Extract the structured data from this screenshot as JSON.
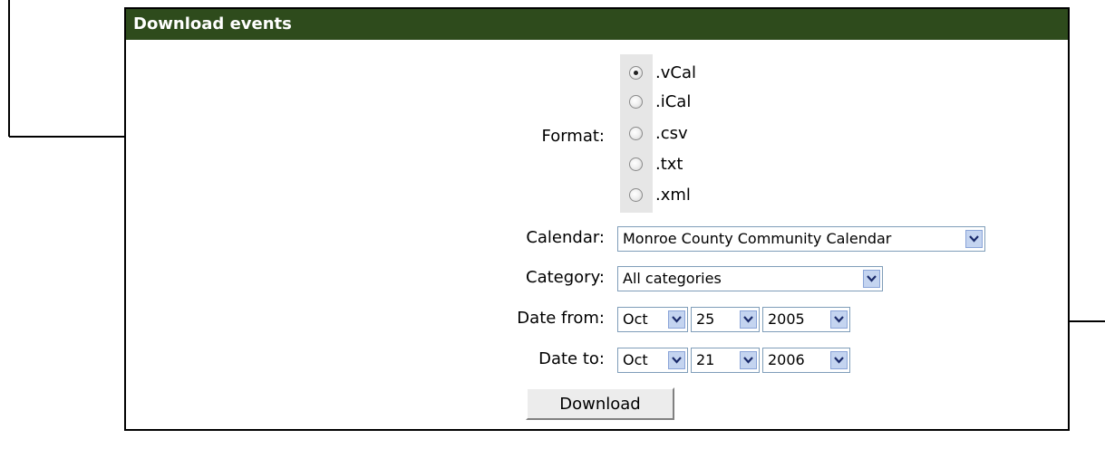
{
  "panel": {
    "title": "Download events"
  },
  "format": {
    "label": "Format:",
    "options": [
      ".vCal",
      ".iCal",
      ".csv",
      ".txt",
      ".xml"
    ],
    "selected": ".vCal"
  },
  "calendar": {
    "label": "Calendar:",
    "value": "Monroe County Community Calendar"
  },
  "category": {
    "label": "Category:",
    "value": "All categories"
  },
  "date_from": {
    "label": "Date from:",
    "month": "Oct",
    "day": "25",
    "year": "2005"
  },
  "date_to": {
    "label": "Date to:",
    "month": "Oct",
    "day": "21",
    "year": "2006"
  },
  "download": {
    "label": "Download"
  },
  "icons": {
    "dropdown": "chevron-down-icon",
    "pointer": "arrow-icon",
    "grouping": "right-brace-icon"
  }
}
